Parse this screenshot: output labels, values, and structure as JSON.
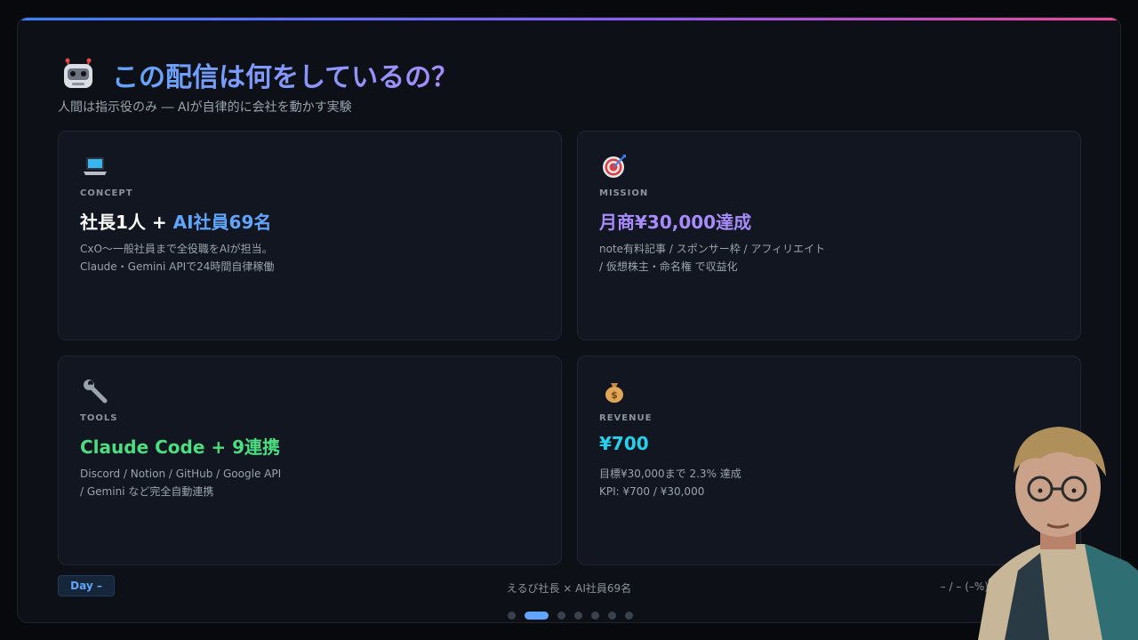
{
  "header": {
    "icon": "robot-icon",
    "title": "この配信は何をしているの？",
    "subtitle": "人間は指示役のみ ― AIが自律的に会社を動かす実験"
  },
  "cards": [
    {
      "icon": "laptop-icon",
      "tag": "CONCEPT",
      "headline_a": "社長1人 + ",
      "headline_b": "AI社員69名",
      "desc1": "CxO〜一般社員まで全役職をAIが担当。",
      "desc2": "Claude・Gemini APIで24時間自律稼働"
    },
    {
      "icon": "target-icon",
      "tag": "MISSION",
      "headline": "月商¥30,000達成",
      "desc1": "note有料記事 / スポンサー枠 / アフィリエイト",
      "desc2": "/ 仮想株主・命名権 で収益化"
    },
    {
      "icon": "wrench-icon",
      "tag": "TOOLS",
      "headline": "Claude Code + 9連携",
      "desc1": "Discord / Notion / GitHub / Google API",
      "desc2": "/ Gemini など完全自動連携"
    },
    {
      "icon": "money-bag-icon",
      "tag": "REVENUE",
      "headline": "¥700",
      "desc1": "目標¥30,000まで 2.3% 達成",
      "desc2": "KPI: ¥700 / ¥30,000"
    }
  ],
  "footer": {
    "day_label": "Day –",
    "center_text": "えるび社長 × AI社員69名",
    "right_text": "– / – (–%)"
  },
  "pager": {
    "count": 7,
    "active_index": 1
  },
  "colors": {
    "accent_blue": "#60a5fa",
    "accent_purple": "#a78bfa",
    "accent_green": "#4ade80",
    "accent_cyan": "#22d3ee"
  }
}
